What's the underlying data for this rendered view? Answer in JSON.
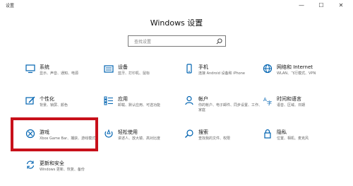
{
  "window": {
    "title": "设置",
    "controls": [
      "—",
      "☐",
      "✕"
    ]
  },
  "heading": "Windows 设置",
  "search": {
    "placeholder": "查找设置"
  },
  "tiles": [
    {
      "id": "system",
      "icon": "monitor-icon",
      "name": "系统",
      "desc": "显示、声音、通知、电源"
    },
    {
      "id": "devices",
      "icon": "keyboard-icon",
      "name": "设备",
      "desc": "蓝牙、打印机、鼠标"
    },
    {
      "id": "phone",
      "icon": "phone-icon",
      "name": "手机",
      "desc": "连接 Android 设备和 iPhone"
    },
    {
      "id": "network",
      "icon": "globe-icon",
      "name": "网络和 Internet",
      "desc": "WLAN、飞行模式、VPN"
    },
    {
      "id": "personal",
      "icon": "brush-icon",
      "name": "个性化",
      "desc": "背景、锁屏、颜色"
    },
    {
      "id": "apps",
      "icon": "apps-list-icon",
      "name": "应用",
      "desc": "卸载、默认应用、可选功能"
    },
    {
      "id": "accounts",
      "icon": "person-icon",
      "name": "帐户",
      "desc": "你的帐户、电子邮件、同步设置、工作、家庭"
    },
    {
      "id": "time",
      "icon": "time-language-icon",
      "name": "时间和语言",
      "desc": "语音、区域、日期"
    },
    {
      "id": "gaming",
      "icon": "xbox-icon",
      "name": "游戏",
      "desc": "Xbox Game Bar、捕获、游戏模式"
    },
    {
      "id": "ease",
      "icon": "ease-of-access-icon",
      "name": "轻松使用",
      "desc": "讲述人、放大镜、高对比度"
    },
    {
      "id": "search",
      "icon": "search-icon",
      "name": "搜索",
      "desc": "查找我的文件、权限"
    },
    {
      "id": "privacy",
      "icon": "lock-icon",
      "name": "隐私",
      "desc": "位置、相机、麦克风"
    },
    {
      "id": "update",
      "icon": "sync-icon",
      "name": "更新和安全",
      "desc": "Windows 更新、恢复、备份"
    }
  ],
  "colors": {
    "icon": "#0063b1",
    "highlight": "#c8101a"
  }
}
